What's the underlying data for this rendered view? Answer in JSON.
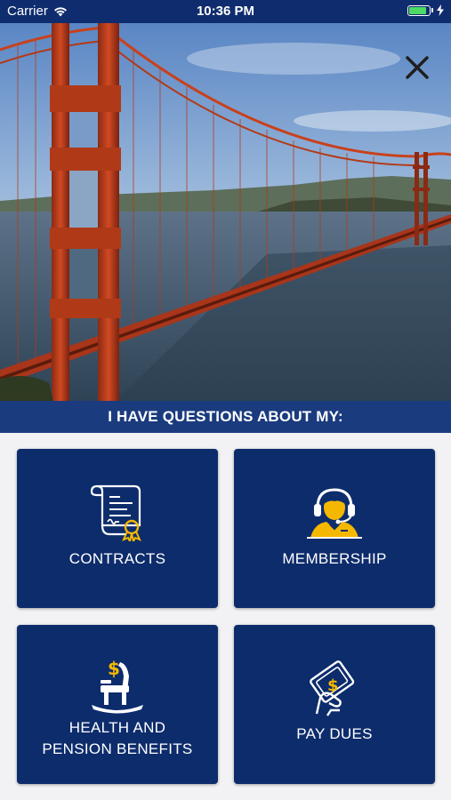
{
  "status_bar": {
    "carrier": "Carrier",
    "time": "10:36 PM"
  },
  "hero": {
    "image": "golden-gate-bridge-photo"
  },
  "header": {
    "title": "I HAVE QUESTIONS ABOUT MY:"
  },
  "tiles": [
    {
      "label": "CONTRACTS",
      "icon": "contract-certificate-icon"
    },
    {
      "label": "MEMBERSHIP",
      "icon": "support-agent-headset-icon"
    },
    {
      "label": "HEALTH AND\nPENSION BENEFITS",
      "icon": "rocking-chair-dollar-icon"
    },
    {
      "label": "PAY DUES",
      "icon": "hand-holding-money-icon"
    }
  ],
  "colors": {
    "status_bar": "#0f2d6e",
    "header_bar": "#1a3b7e",
    "tile_background": "#0d2c6c",
    "accent_gold": "#f5b800",
    "page_background": "#f2f2f4"
  }
}
